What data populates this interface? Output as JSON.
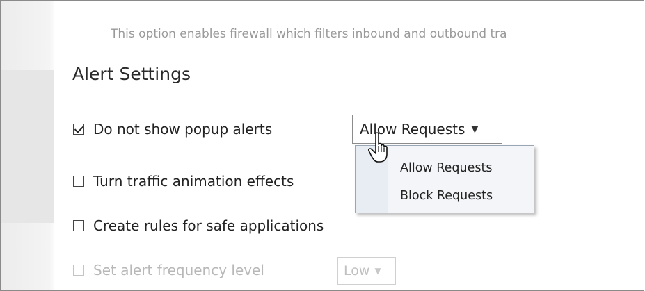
{
  "description": "This option enables firewall which filters inbound and outbound tra",
  "alert_settings": {
    "heading": "Alert Settings",
    "options": [
      {
        "label": "Do not show popup alerts",
        "checked": true,
        "enabled": true
      },
      {
        "label": "Turn traffic animation effects",
        "checked": false,
        "enabled": true
      },
      {
        "label": "Create rules for safe applications",
        "checked": false,
        "enabled": true
      },
      {
        "label": "Set alert frequency level",
        "checked": false,
        "enabled": false
      }
    ],
    "popup_action_select": {
      "value": "Allow Requests",
      "options": [
        "Allow Requests",
        "Block Requests"
      ]
    },
    "frequency_select": {
      "value": "Low"
    }
  },
  "icons": {
    "select_arrow": "triangle-down-icon",
    "cursor": "hand-pointer-icon"
  },
  "colors": {
    "dropdown_bg": "#f3f5f8",
    "disabled_text": "#b8b8b8",
    "description_text": "#9a9a9a"
  }
}
